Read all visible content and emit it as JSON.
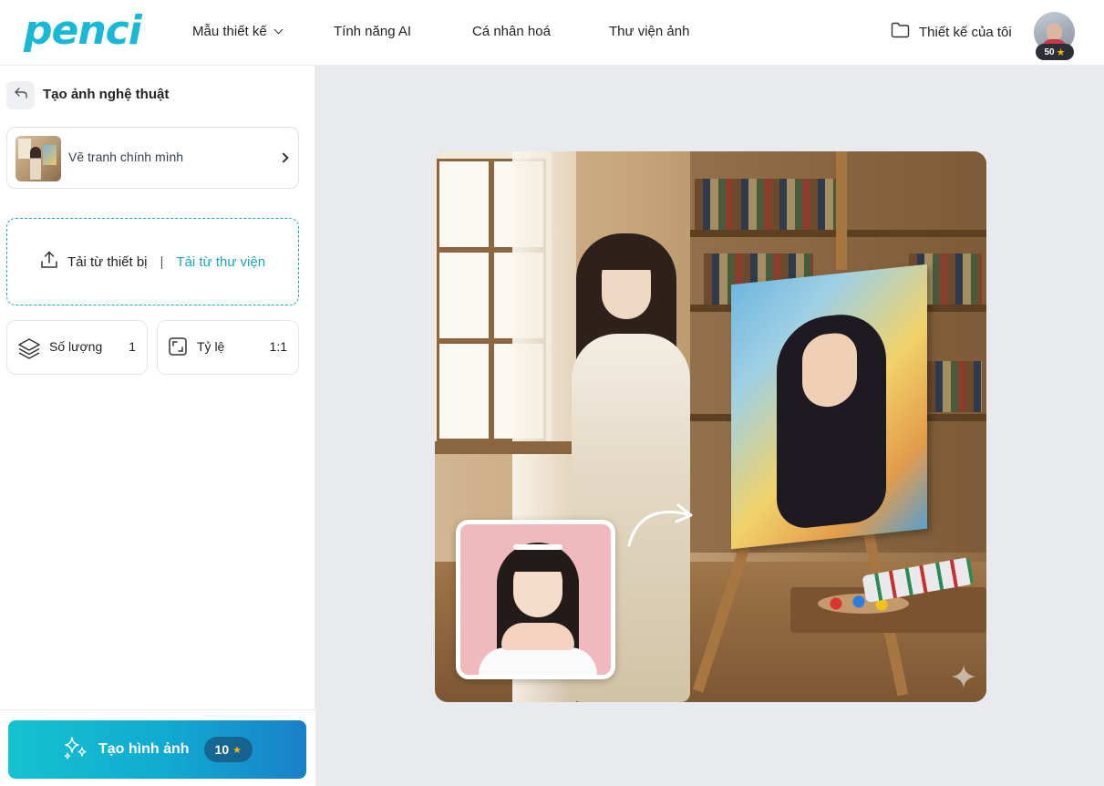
{
  "header": {
    "logo": "penci",
    "nav": {
      "templates": "Mẫu thiết kế",
      "ai_features": "Tính năng AI",
      "personalize": "Cá nhân hoá",
      "photo_library": "Thư viện ảnh"
    },
    "my_designs": "Thiết kế của tôi",
    "coins": "50"
  },
  "sidebar": {
    "title": "Tạo ảnh nghệ thuật",
    "style_name": "Vẽ tranh chính mình",
    "upload": {
      "device": "Tải từ thiết bị",
      "separator": "|",
      "library": "Tải từ thư viện"
    },
    "quantity": {
      "label": "Số lượng",
      "value": "1"
    },
    "ratio": {
      "label": "Tỷ lệ",
      "value": "1:1"
    },
    "generate": {
      "label": "Tạo hình ảnh",
      "cost": "10"
    }
  },
  "icons": {
    "folder": "folder-icon",
    "back": "back-arrow-icon",
    "upload": "upload-icon",
    "layers": "layers-icon",
    "ratio": "aspect-ratio-icon",
    "sparkles": "sparkles-icon",
    "star": "star-icon"
  },
  "colors": {
    "brand": "#19b8d4",
    "accent_link": "#19a9bf",
    "button_gradient_start": "#14c3cf",
    "button_gradient_end": "#1a80c9",
    "coin_star": "#f7b500"
  }
}
